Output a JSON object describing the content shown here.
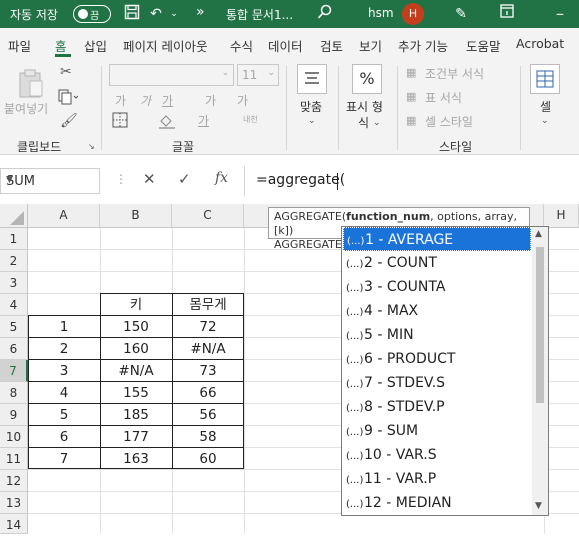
{
  "titlebar": {
    "autosave_label": "자동 저장",
    "autosave_state": "끔",
    "more": "»",
    "doc_title": "통합 문서1...",
    "user": "hsm",
    "avatar": "H"
  },
  "menu": {
    "tabs": [
      "파일",
      "홈",
      "삽입",
      "페이지 레이아웃",
      "수식",
      "데이터",
      "검토",
      "보기",
      "추가 기능",
      "도움말",
      "Acrobat"
    ],
    "active": "홈"
  },
  "ribbon": {
    "clipboard": {
      "paste": "붙여넣기",
      "label": "클립보드"
    },
    "font": {
      "size": "11",
      "grow": "가",
      "shrink": "가",
      "bold": "가",
      "italic": "가",
      "underline": "가",
      "strike": "가",
      "phonetic": "내천",
      "label": "글꼴"
    },
    "align": {
      "label": "맞춤"
    },
    "number": {
      "label_line1": "표시 형",
      "label_line2": "식",
      "symbol": "%"
    },
    "styles": {
      "conditional": "조건부 서식",
      "table": "표 서식",
      "cell": "셀 스타일",
      "label": "스타일"
    },
    "cells": {
      "label": "셀"
    }
  },
  "formula_bar": {
    "name_box": "SUM",
    "formula": "=aggregate("
  },
  "sheet": {
    "columns": [
      "A",
      "B",
      "C",
      "H"
    ],
    "rows": [
      "1",
      "2",
      "3",
      "4",
      "5",
      "6",
      "7",
      "8",
      "9",
      "10",
      "11",
      "12",
      "13",
      "14"
    ],
    "header": {
      "b": "키",
      "c": "몸무게"
    },
    "data": [
      {
        "a": "1",
        "b": "150",
        "c": "72"
      },
      {
        "a": "2",
        "b": "160",
        "c": "#N/A"
      },
      {
        "a": "3",
        "b": "#N/A",
        "c": "73"
      },
      {
        "a": "4",
        "b": "155",
        "c": "66"
      },
      {
        "a": "5",
        "b": "185",
        "c": "56"
      },
      {
        "a": "6",
        "b": "177",
        "c": "58"
      },
      {
        "a": "7",
        "b": "163",
        "c": "60"
      }
    ]
  },
  "tooltip": {
    "fn": "AGGREGATE(",
    "arg_bold": "function_num",
    "rest": ", options, array, [k])",
    "line2": "AGGREGATE("
  },
  "autocomplete": {
    "items": [
      "1 - AVERAGE",
      "2 - COUNT",
      "3 - COUNTA",
      "4 - MAX",
      "5 - MIN",
      "6 - PRODUCT",
      "7 - STDEV.S",
      "8 - STDEV.P",
      "9 - SUM",
      "10 - VAR.S",
      "11 - VAR.P",
      "12 - MEDIAN"
    ],
    "icon": "(...)",
    "selected_index": 0,
    "accent": "#1a73d9"
  },
  "colors": {
    "brand": "#217346",
    "selection": "#1a73d9"
  }
}
